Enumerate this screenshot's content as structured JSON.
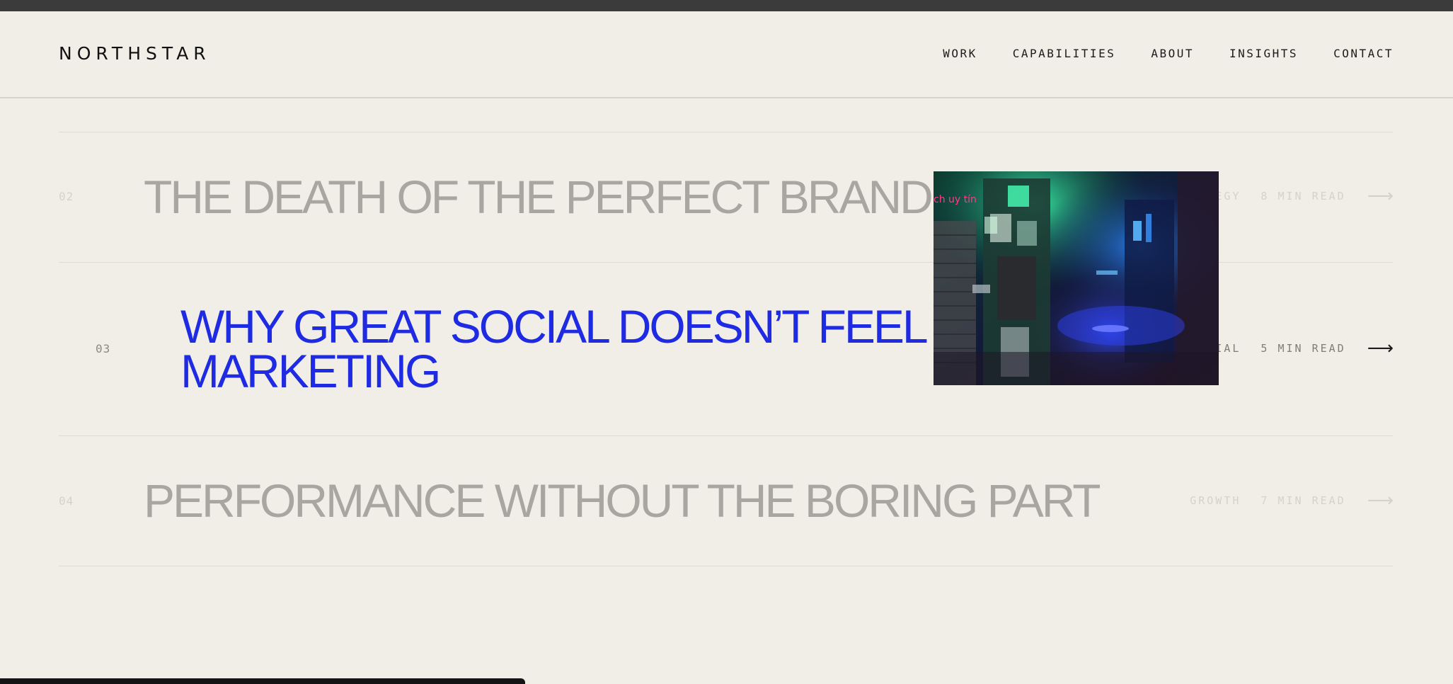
{
  "header": {
    "logo": "NORTHSTAR",
    "nav": [
      "WORK",
      "CAPABILITIES",
      "ABOUT",
      "INSIGHTS",
      "CONTACT"
    ]
  },
  "articles": [
    {
      "number": "02",
      "title": "THE DEATH OF THE PERFECT BRAND",
      "category": "STRATEGY",
      "read_time": "8 MIN READ",
      "arrow": "⟶"
    },
    {
      "number": "03",
      "title_line1": "WHY GREAT SOCIAL DOESN’T FEEL LIKE",
      "title_line2": "MARKETING",
      "category": "SOCIAL",
      "read_time": "5 MIN READ",
      "arrow": "⟶"
    },
    {
      "number": "04",
      "title": "PERFORMANCE WITHOUT THE BORING PART",
      "category": "GROWTH",
      "read_time": "7 MIN READ",
      "arrow": "⟶"
    }
  ],
  "hover_image": {
    "neon_sign": "ch uy tín"
  },
  "colors": {
    "background": "#f1eee8",
    "accent": "#1f2be3",
    "muted_title": "#a9a6a1",
    "text": "#1b1b1b"
  },
  "icons": {
    "arrow": "arrow-right-icon"
  }
}
